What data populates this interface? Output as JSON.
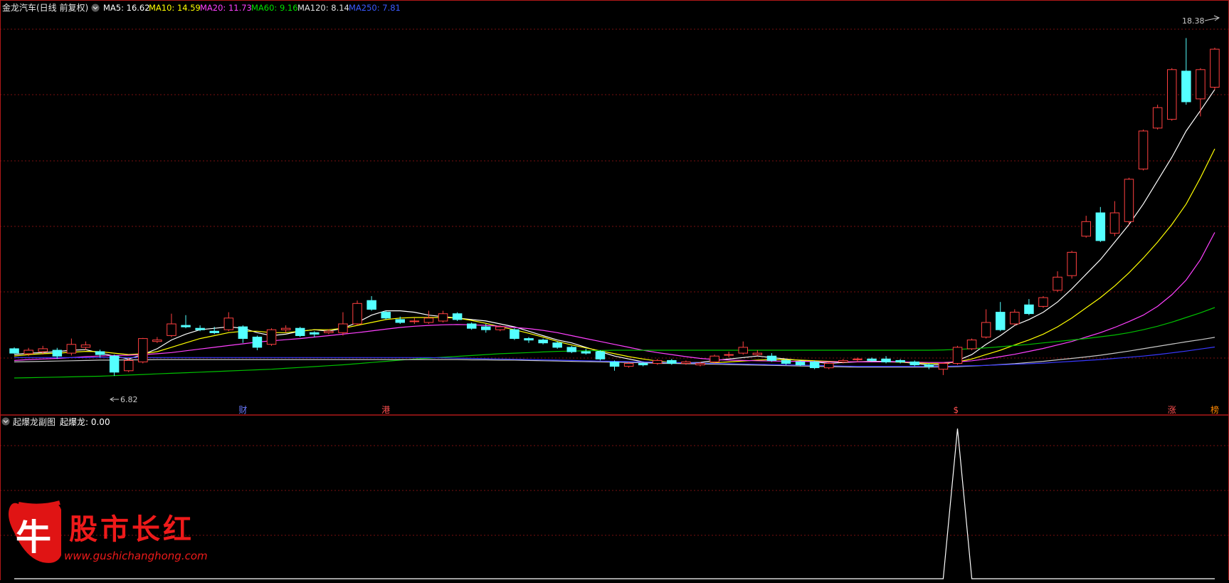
{
  "header": {
    "stock_name": "金龙汽车(日线 前复权)",
    "ma5_label": "MA5: 16.62",
    "ma10_label": "MA10: 14.59",
    "ma20_label": "MA20: 11.73",
    "ma60_label": "MA60: 9.16",
    "ma120_label": "MA120: 8.14",
    "ma250_label": "MA250: 7.81"
  },
  "colors": {
    "up": "#ff4040",
    "down": "#54ffff",
    "grid": "#7a1010",
    "ma5": "#ffffff",
    "ma10": "#ffff00",
    "ma20": "#ff40ff",
    "ma60": "#00c000",
    "ma120": "#c8c8c8",
    "ma250": "#3838ff"
  },
  "event_markers": [
    {
      "text": "财",
      "color": "#6a7aff"
    },
    {
      "text": "港",
      "color": "#ff5050"
    },
    {
      "text": "$",
      "color": "#ff5050"
    },
    {
      "text": "涨",
      "color": "#ff5050"
    },
    {
      "text": "榜",
      "color": "#ff8800"
    }
  ],
  "sub_panel": {
    "title": "起爆龙副图",
    "value_label": "起爆龙: 0.00"
  },
  "watermark": {
    "logo_char": "牛",
    "brand": "股市长红",
    "url": "www.gushichanghong.com"
  },
  "chart_data": [
    {
      "type": "candlestick",
      "title": "金龙汽车(日线 前复权)",
      "ylim": [
        5.8,
        19.0
      ],
      "annotations": [
        {
          "text": "18.38",
          "kind": "high"
        },
        {
          "text": "6.82",
          "kind": "low"
        }
      ],
      "candles": [
        [
          7.75,
          7.6,
          7.8,
          7.58
        ],
        [
          7.58,
          7.7,
          7.78,
          7.5
        ],
        [
          7.65,
          7.75,
          7.85,
          7.55
        ],
        [
          7.7,
          7.5,
          7.78,
          7.4
        ],
        [
          7.6,
          7.9,
          8.1,
          7.52
        ],
        [
          7.8,
          7.88,
          8.0,
          7.7
        ],
        [
          7.65,
          7.55,
          7.72,
          7.45
        ],
        [
          7.5,
          6.95,
          7.55,
          6.82
        ],
        [
          7.0,
          7.35,
          7.42,
          6.95
        ],
        [
          7.3,
          8.1,
          8.12,
          7.25
        ],
        [
          8.0,
          8.05,
          8.15,
          7.95
        ],
        [
          8.2,
          8.6,
          8.95,
          8.15
        ],
        [
          8.55,
          8.5,
          8.9,
          8.45
        ],
        [
          8.45,
          8.4,
          8.55,
          8.35
        ],
        [
          8.35,
          8.3,
          8.5,
          8.25
        ],
        [
          8.4,
          8.8,
          9.0,
          8.35
        ],
        [
          8.5,
          8.1,
          8.55,
          7.95
        ],
        [
          8.15,
          7.8,
          8.2,
          7.7
        ],
        [
          7.9,
          8.4,
          8.45,
          7.85
        ],
        [
          8.4,
          8.45,
          8.55,
          8.3
        ],
        [
          8.45,
          8.2,
          8.5,
          8.15
        ],
        [
          8.3,
          8.25,
          8.35,
          8.15
        ],
        [
          8.3,
          8.35,
          8.42,
          8.25
        ],
        [
          8.3,
          8.6,
          9.0,
          8.2
        ],
        [
          8.6,
          9.3,
          9.4,
          8.55
        ],
        [
          9.4,
          9.1,
          9.55,
          9.05
        ],
        [
          9.0,
          8.8,
          9.05,
          8.75
        ],
        [
          8.75,
          8.65,
          8.85,
          8.6
        ],
        [
          8.7,
          8.7,
          8.8,
          8.6
        ],
        [
          8.65,
          8.8,
          9.05,
          8.6
        ],
        [
          8.7,
          8.95,
          9.05,
          8.65
        ],
        [
          8.95,
          8.75,
          9.0,
          8.7
        ],
        [
          8.6,
          8.45,
          8.65,
          8.4
        ],
        [
          8.5,
          8.4,
          8.6,
          8.3
        ],
        [
          8.4,
          8.5,
          8.55,
          8.35
        ],
        [
          8.4,
          8.1,
          8.45,
          8.05
        ],
        [
          8.1,
          8.05,
          8.15,
          7.95
        ],
        [
          8.05,
          7.95,
          8.1,
          7.9
        ],
        [
          7.95,
          7.8,
          8.0,
          7.75
        ],
        [
          7.8,
          7.65,
          7.85,
          7.6
        ],
        [
          7.65,
          7.6,
          7.75,
          7.55
        ],
        [
          7.65,
          7.4,
          7.7,
          7.35
        ],
        [
          7.3,
          7.15,
          7.35,
          7.0
        ],
        [
          7.15,
          7.25,
          7.3,
          7.1
        ],
        [
          7.25,
          7.2,
          7.3,
          7.15
        ],
        [
          7.25,
          7.35,
          7.4,
          7.2
        ],
        [
          7.35,
          7.25,
          7.4,
          7.2
        ],
        [
          7.25,
          7.3,
          7.35,
          7.2
        ],
        [
          7.2,
          7.25,
          7.3,
          7.15
        ],
        [
          7.3,
          7.5,
          7.55,
          7.25
        ],
        [
          7.55,
          7.55,
          7.65,
          7.45
        ],
        [
          7.6,
          7.8,
          8.0,
          7.55
        ],
        [
          7.55,
          7.6,
          7.7,
          7.5
        ],
        [
          7.5,
          7.35,
          7.6,
          7.3
        ],
        [
          7.35,
          7.25,
          7.4,
          7.2
        ],
        [
          7.3,
          7.2,
          7.35,
          7.15
        ],
        [
          7.3,
          7.1,
          7.35,
          7.05
        ],
        [
          7.1,
          7.25,
          7.3,
          7.05
        ],
        [
          7.3,
          7.35,
          7.4,
          7.25
        ],
        [
          7.4,
          7.4,
          7.45,
          7.3
        ],
        [
          7.4,
          7.35,
          7.45,
          7.3
        ],
        [
          7.4,
          7.3,
          7.5,
          7.25
        ],
        [
          7.35,
          7.3,
          7.4,
          7.25
        ],
        [
          7.3,
          7.2,
          7.35,
          7.15
        ],
        [
          7.2,
          7.15,
          7.25,
          7.05
        ],
        [
          7.05,
          7.25,
          7.28,
          6.85
        ],
        [
          7.25,
          7.8,
          7.85,
          7.2
        ],
        [
          7.75,
          8.05,
          8.1,
          7.7
        ],
        [
          8.15,
          8.65,
          9.1,
          8.1
        ],
        [
          9.0,
          8.4,
          9.35,
          8.35
        ],
        [
          8.6,
          9.0,
          9.1,
          8.55
        ],
        [
          9.25,
          8.95,
          9.45,
          8.9
        ],
        [
          9.2,
          9.5,
          9.55,
          9.15
        ],
        [
          9.75,
          10.2,
          10.4,
          9.7
        ],
        [
          10.25,
          11.05,
          11.1,
          10.15
        ],
        [
          11.6,
          12.1,
          12.3,
          11.55
        ],
        [
          12.4,
          11.45,
          12.6,
          11.4
        ],
        [
          11.7,
          12.4,
          12.8,
          11.6
        ],
        [
          12.1,
          13.55,
          13.6,
          12.0
        ],
        [
          13.9,
          15.2,
          15.25,
          13.85
        ],
        [
          15.3,
          16.0,
          16.1,
          15.25
        ],
        [
          15.6,
          17.3,
          17.35,
          15.55
        ],
        [
          17.25,
          16.2,
          18.38,
          16.1
        ],
        [
          16.3,
          17.3,
          17.35,
          15.7
        ],
        [
          16.7,
          18.0,
          18.05,
          16.6
        ]
      ],
      "series": [
        {
          "name": "MA5",
          "values": [
            7.55,
            7.6,
            7.62,
            7.65,
            7.7,
            7.72,
            7.6,
            7.5,
            7.4,
            7.55,
            7.75,
            8.05,
            8.25,
            8.4,
            8.45,
            8.5,
            8.45,
            8.3,
            8.2,
            8.25,
            8.35,
            8.4,
            8.35,
            8.45,
            8.65,
            8.9,
            9.05,
            9.05,
            9.0,
            8.9,
            8.85,
            8.8,
            8.75,
            8.7,
            8.6,
            8.5,
            8.35,
            8.2,
            8.05,
            7.95,
            7.8,
            7.65,
            7.5,
            7.4,
            7.3,
            7.25,
            7.25,
            7.27,
            7.28,
            7.35,
            7.4,
            7.45,
            7.5,
            7.45,
            7.4,
            7.35,
            7.3,
            7.25,
            7.28,
            7.3,
            7.32,
            7.32,
            7.3,
            7.25,
            7.2,
            7.2,
            7.35,
            7.55,
            7.9,
            8.2,
            8.55,
            8.75,
            9.0,
            9.35,
            9.8,
            10.3,
            10.8,
            11.4,
            12.0,
            12.7,
            13.5,
            14.3,
            15.2,
            15.9,
            16.62
          ]
        },
        {
          "name": "MA10",
          "values": [
            7.5,
            7.55,
            7.58,
            7.6,
            7.63,
            7.66,
            7.65,
            7.6,
            7.55,
            7.58,
            7.65,
            7.8,
            7.95,
            8.1,
            8.2,
            8.3,
            8.35,
            8.35,
            8.3,
            8.3,
            8.35,
            8.4,
            8.4,
            8.45,
            8.55,
            8.65,
            8.75,
            8.8,
            8.82,
            8.82,
            8.82,
            8.8,
            8.72,
            8.62,
            8.5,
            8.4,
            8.28,
            8.15,
            8.0,
            7.88,
            7.78,
            7.68,
            7.58,
            7.48,
            7.4,
            7.33,
            7.28,
            7.25,
            7.25,
            7.27,
            7.3,
            7.33,
            7.36,
            7.38,
            7.38,
            7.36,
            7.34,
            7.32,
            7.3,
            7.3,
            7.3,
            7.3,
            7.29,
            7.27,
            7.25,
            7.25,
            7.3,
            7.4,
            7.55,
            7.7,
            7.88,
            8.05,
            8.25,
            8.5,
            8.8,
            9.15,
            9.5,
            9.9,
            10.35,
            10.85,
            11.4,
            12.0,
            12.7,
            13.6,
            14.59
          ]
        },
        {
          "name": "MA20",
          "values": [
            7.35,
            7.38,
            7.4,
            7.42,
            7.45,
            7.48,
            7.5,
            7.52,
            7.53,
            7.55,
            7.58,
            7.62,
            7.68,
            7.74,
            7.8,
            7.86,
            7.92,
            7.98,
            8.02,
            8.06,
            8.1,
            8.15,
            8.2,
            8.25,
            8.3,
            8.36,
            8.42,
            8.48,
            8.52,
            8.55,
            8.57,
            8.58,
            8.57,
            8.55,
            8.52,
            8.48,
            8.44,
            8.38,
            8.3,
            8.2,
            8.1,
            8.0,
            7.9,
            7.8,
            7.7,
            7.62,
            7.55,
            7.48,
            7.42,
            7.38,
            7.36,
            7.35,
            7.34,
            7.33,
            7.32,
            7.32,
            7.31,
            7.3,
            7.3,
            7.3,
            7.3,
            7.3,
            7.3,
            7.29,
            7.28,
            7.28,
            7.3,
            7.34,
            7.4,
            7.48,
            7.56,
            7.66,
            7.76,
            7.88,
            8.0,
            8.15,
            8.3,
            8.48,
            8.68,
            8.9,
            9.2,
            9.6,
            10.1,
            10.8,
            11.73
          ]
        },
        {
          "name": "MA60",
          "values": [
            6.75,
            6.76,
            6.77,
            6.78,
            6.79,
            6.8,
            6.81,
            6.83,
            6.85,
            6.87,
            6.89,
            6.91,
            6.93,
            6.95,
            6.97,
            6.99,
            7.01,
            7.03,
            7.05,
            7.08,
            7.11,
            7.14,
            7.17,
            7.2,
            7.24,
            7.28,
            7.32,
            7.36,
            7.4,
            7.43,
            7.46,
            7.49,
            7.52,
            7.55,
            7.58,
            7.6,
            7.62,
            7.64,
            7.66,
            7.67,
            7.68,
            7.69,
            7.7,
            7.7,
            7.7,
            7.7,
            7.7,
            7.7,
            7.7,
            7.7,
            7.7,
            7.7,
            7.7,
            7.7,
            7.7,
            7.7,
            7.7,
            7.7,
            7.7,
            7.7,
            7.7,
            7.7,
            7.7,
            7.7,
            7.7,
            7.71,
            7.73,
            7.75,
            7.78,
            7.82,
            7.86,
            7.9,
            7.95,
            8.0,
            8.05,
            8.1,
            8.16,
            8.22,
            8.3,
            8.4,
            8.52,
            8.66,
            8.82,
            8.98,
            9.16
          ]
        },
        {
          "name": "MA120",
          "values": [
            7.3,
            7.31,
            7.32,
            7.33,
            7.34,
            7.35,
            7.36,
            7.36,
            7.37,
            7.37,
            7.38,
            7.38,
            7.38,
            7.38,
            7.38,
            7.38,
            7.38,
            7.38,
            7.38,
            7.38,
            7.38,
            7.38,
            7.38,
            7.38,
            7.38,
            7.38,
            7.38,
            7.38,
            7.38,
            7.38,
            7.38,
            7.38,
            7.37,
            7.37,
            7.36,
            7.36,
            7.35,
            7.34,
            7.33,
            7.32,
            7.31,
            7.3,
            7.29,
            7.28,
            7.27,
            7.26,
            7.25,
            7.24,
            7.23,
            7.22,
            7.21,
            7.2,
            7.19,
            7.18,
            7.17,
            7.16,
            7.15,
            7.14,
            7.13,
            7.12,
            7.12,
            7.12,
            7.12,
            7.12,
            7.12,
            7.13,
            7.14,
            7.16,
            7.18,
            7.21,
            7.24,
            7.28,
            7.32,
            7.37,
            7.42,
            7.47,
            7.53,
            7.6,
            7.67,
            7.75,
            7.83,
            7.91,
            7.99,
            8.06,
            8.14
          ]
        },
        {
          "name": "MA250",
          "values": [
            7.45,
            7.45,
            7.45,
            7.45,
            7.45,
            7.45,
            7.45,
            7.45,
            7.45,
            7.45,
            7.45,
            7.45,
            7.45,
            7.45,
            7.45,
            7.45,
            7.45,
            7.45,
            7.45,
            7.45,
            7.45,
            7.45,
            7.45,
            7.45,
            7.45,
            7.45,
            7.45,
            7.45,
            7.45,
            7.45,
            7.44,
            7.43,
            7.42,
            7.41,
            7.4,
            7.39,
            7.38,
            7.37,
            7.36,
            7.35,
            7.34,
            7.33,
            7.32,
            7.31,
            7.3,
            7.29,
            7.28,
            7.27,
            7.26,
            7.25,
            7.24,
            7.23,
            7.22,
            7.21,
            7.2,
            7.19,
            7.18,
            7.17,
            7.16,
            7.15,
            7.15,
            7.15,
            7.15,
            7.15,
            7.15,
            7.15,
            7.16,
            7.17,
            7.18,
            7.2,
            7.22,
            7.24,
            7.26,
            7.29,
            7.32,
            7.35,
            7.38,
            7.42,
            7.46,
            7.5,
            7.55,
            7.61,
            7.67,
            7.74,
            7.81
          ]
        }
      ]
    },
    {
      "type": "line",
      "title": "起爆龙副图",
      "ylim": [
        0,
        1
      ],
      "series": [
        {
          "name": "起爆龙",
          "values": [
            0,
            0,
            0,
            0,
            0,
            0,
            0,
            0,
            0,
            0,
            0,
            0,
            0,
            0,
            0,
            0,
            0,
            0,
            0,
            0,
            0,
            0,
            0,
            0,
            0,
            0,
            0,
            0,
            0,
            0,
            0,
            0,
            0,
            0,
            0,
            0,
            0,
            0,
            0,
            0,
            0,
            0,
            0,
            0,
            0,
            0,
            0,
            0,
            0,
            0,
            0,
            0,
            0,
            0,
            0,
            0,
            0,
            0,
            0,
            0,
            0,
            0,
            0,
            0,
            0,
            0,
            1,
            0,
            0,
            0,
            0,
            0,
            0,
            0,
            0,
            0,
            0,
            0,
            0,
            0,
            0,
            0,
            0,
            0,
            0
          ]
        }
      ]
    }
  ]
}
